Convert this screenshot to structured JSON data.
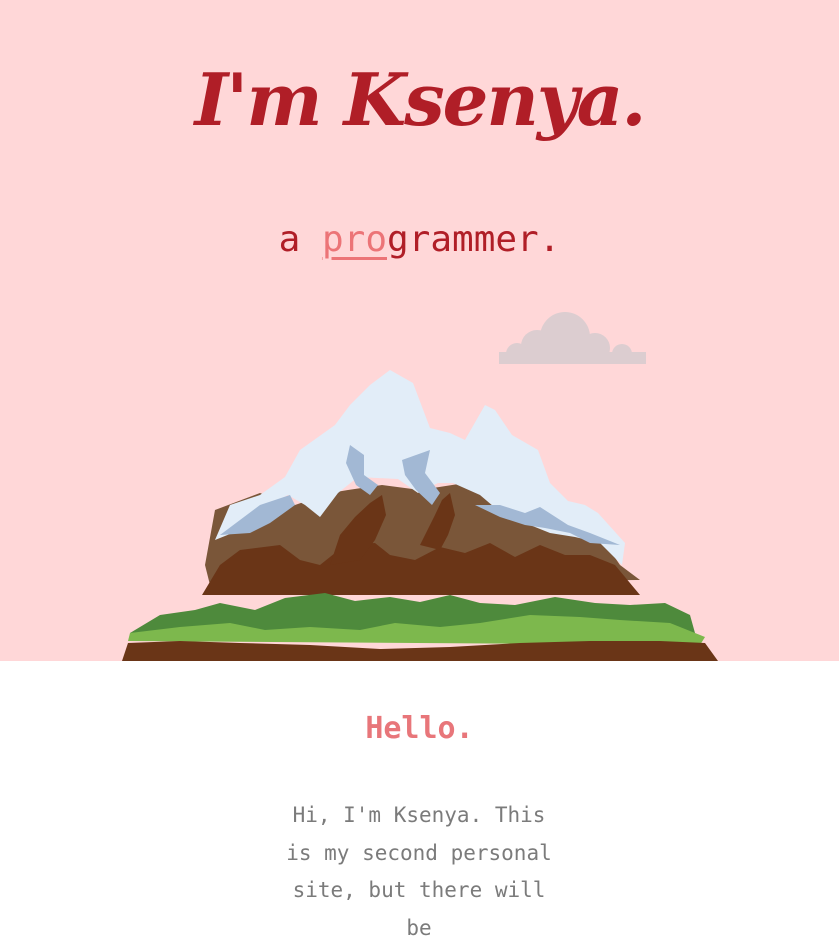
{
  "hero": {
    "title": "I'm Ksenya.",
    "subtitle_prefix": "a ",
    "subtitle_highlight": "pro",
    "subtitle_suffix": "grammer."
  },
  "about": {
    "heading": "Hello.",
    "text": "Hi, I'm Ksenya. This is my second personal site, but there will be"
  },
  "colors": {
    "hero_background": "#ffd7d8",
    "title_red": "#b01e27",
    "accent_pink": "#e8767a",
    "body_text_gray": "#7b7b7b"
  },
  "icons": {
    "cloud": "cloud-icon",
    "mountain": "mountain-illustration"
  }
}
